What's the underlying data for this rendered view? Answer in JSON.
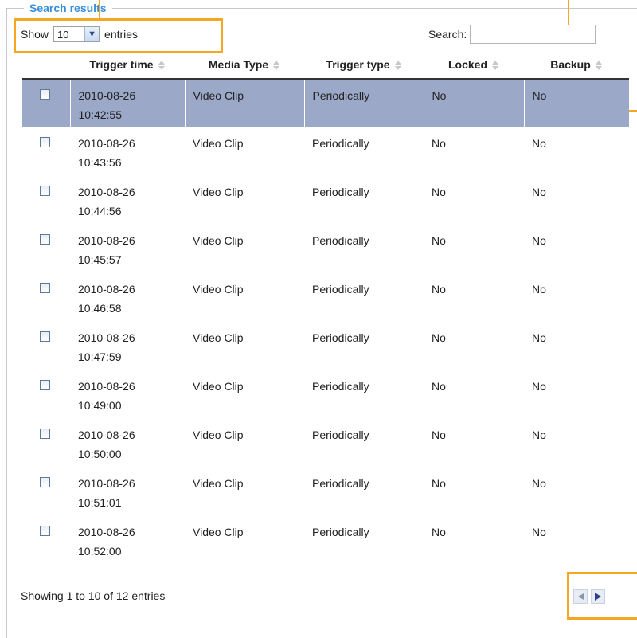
{
  "panel": {
    "legend": "Search results"
  },
  "length_control": {
    "prefix": "Show",
    "selected": "10",
    "suffix": "entries"
  },
  "search": {
    "label": "Search:",
    "value": ""
  },
  "table": {
    "columns": [
      "Trigger time",
      "Media Type",
      "Trigger type",
      "Locked",
      "Backup"
    ],
    "rows": [
      {
        "date": "2010-08-26",
        "time": "10:42:55",
        "media": "Video Clip",
        "trigger": "Periodically",
        "locked": "No",
        "backup": "No",
        "selected": true
      },
      {
        "date": "2010-08-26",
        "time": "10:43:56",
        "media": "Video Clip",
        "trigger": "Periodically",
        "locked": "No",
        "backup": "No"
      },
      {
        "date": "2010-08-26",
        "time": "10:44:56",
        "media": "Video Clip",
        "trigger": "Periodically",
        "locked": "No",
        "backup": "No"
      },
      {
        "date": "2010-08-26",
        "time": "10:45:57",
        "media": "Video Clip",
        "trigger": "Periodically",
        "locked": "No",
        "backup": "No"
      },
      {
        "date": "2010-08-26",
        "time": "10:46:58",
        "media": "Video Clip",
        "trigger": "Periodically",
        "locked": "No",
        "backup": "No"
      },
      {
        "date": "2010-08-26",
        "time": "10:47:59",
        "media": "Video Clip",
        "trigger": "Periodically",
        "locked": "No",
        "backup": "No"
      },
      {
        "date": "2010-08-26",
        "time": "10:49:00",
        "media": "Video Clip",
        "trigger": "Periodically",
        "locked": "No",
        "backup": "No"
      },
      {
        "date": "2010-08-26",
        "time": "10:50:00",
        "media": "Video Clip",
        "trigger": "Periodically",
        "locked": "No",
        "backup": "No"
      },
      {
        "date": "2010-08-26",
        "time": "10:51:01",
        "media": "Video Clip",
        "trigger": "Periodically",
        "locked": "No",
        "backup": "No"
      },
      {
        "date": "2010-08-26",
        "time": "10:52:00",
        "media": "Video Clip",
        "trigger": "Periodically",
        "locked": "No",
        "backup": "No"
      }
    ]
  },
  "footer": {
    "info": "Showing 1 to 10 of 12 entries"
  },
  "pager": {
    "prev_icon": "previous-page-icon",
    "next_icon": "next-page-icon"
  },
  "colors": {
    "accent": "#3a8fd9",
    "callout": "#f5a623",
    "selected_row": "#9ba8c8"
  }
}
